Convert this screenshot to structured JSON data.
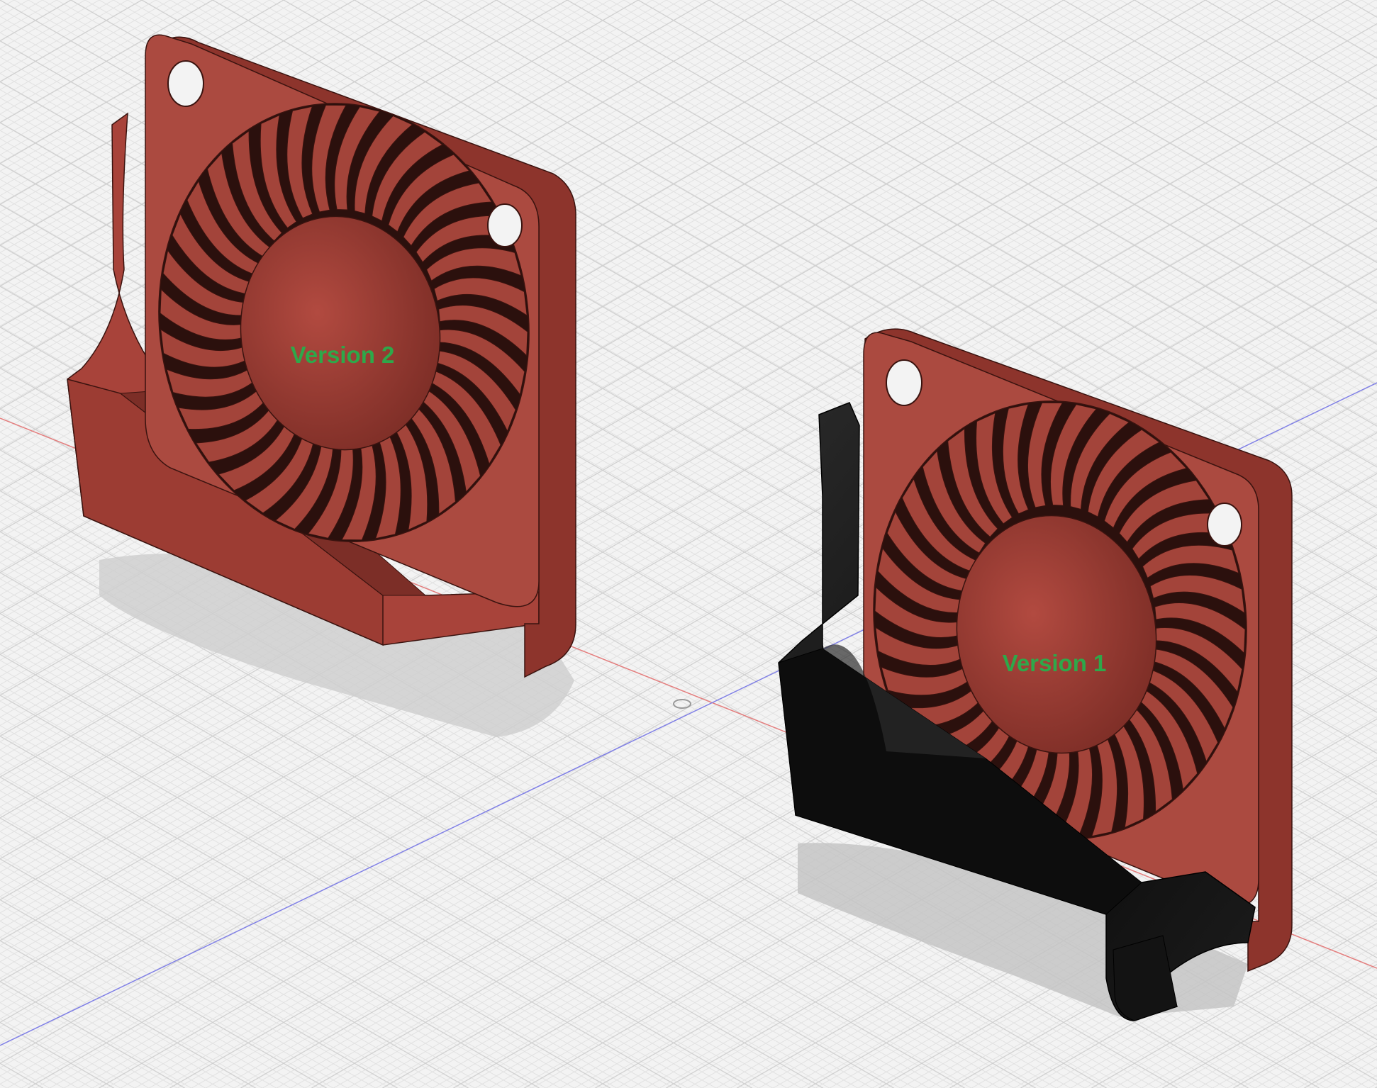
{
  "viewport": {
    "background": "#f3f3f3",
    "grid_minor_color": "#e1e1e1",
    "grid_major_color": "#cdcdcd",
    "x_axis_color": "#e07a7a",
    "y_axis_color": "#7a7ae0"
  },
  "models": [
    {
      "label": "Version 2",
      "fan_color": "#a8433a",
      "bracket_color": "#a8433a"
    },
    {
      "label": "Version 1",
      "fan_color": "#a8433a",
      "bracket_color": "#111111"
    }
  ],
  "icons": {
    "origin": "origin-icon"
  }
}
